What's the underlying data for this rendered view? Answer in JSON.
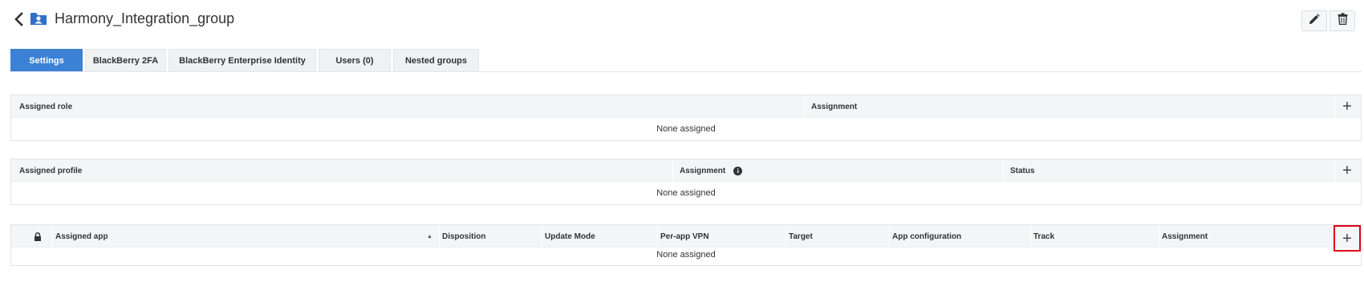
{
  "header": {
    "title": "Harmony_Integration_group",
    "back_icon": "chevron-left-icon",
    "group_icon": "user-group-folder-icon",
    "edit_icon": "pencil-icon",
    "delete_icon": "trash-icon"
  },
  "tabs": [
    {
      "label": "Settings",
      "active": true
    },
    {
      "label": "BlackBerry 2FA",
      "active": false
    },
    {
      "label": "BlackBerry Enterprise Identity",
      "active": false
    },
    {
      "label": "Users (0)",
      "active": false
    },
    {
      "label": "Nested groups",
      "active": false
    }
  ],
  "roles_table": {
    "columns": [
      "Assigned role",
      "Assignment"
    ],
    "empty_text": "None assigned",
    "add_label": "+"
  },
  "profiles_table": {
    "columns": [
      "Assigned profile",
      "Assignment",
      "Status"
    ],
    "info_glyph": "i",
    "empty_text": "None assigned",
    "add_label": "+"
  },
  "apps_table": {
    "columns": [
      "Assigned app",
      "Disposition",
      "Update Mode",
      "Per-app VPN",
      "Target",
      "App configuration",
      "Track",
      "Assignment"
    ],
    "sort_indicator": "▲",
    "empty_text": "None assigned",
    "add_label": "+"
  },
  "colors": {
    "accent": "#3b82d6",
    "highlight": "#e3001b",
    "header_bg": "#f4f5f7"
  }
}
